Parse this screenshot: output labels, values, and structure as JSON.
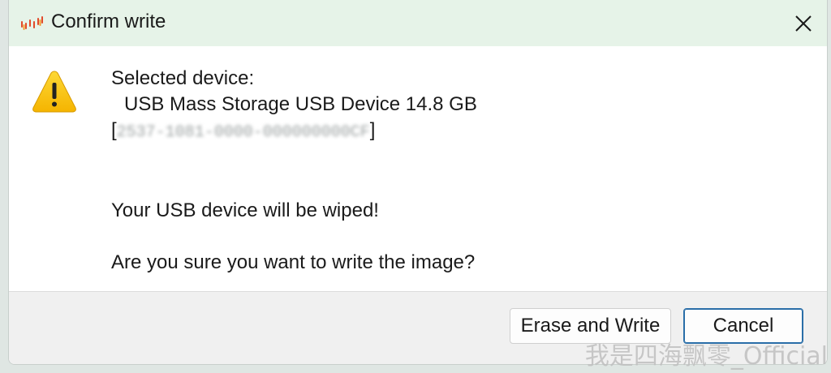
{
  "window": {
    "title": "Confirm write",
    "app_icon": "app-activity-icon",
    "close_icon": "close-icon"
  },
  "message": {
    "warning_icon": "warning-icon",
    "selected_device_label": "Selected device:",
    "device_name": "USB Mass Storage USB Device 14.8 GB",
    "device_id_open": "[",
    "device_id_blurred": "2537-1081-0000-000000000CF",
    "device_id_close": "]",
    "warning_text": "Your USB device will be wiped!",
    "question_text": "Are you sure you want to write the image?"
  },
  "buttons": {
    "erase_write_label": "Erase and Write",
    "cancel_label": "Cancel"
  },
  "watermark": {
    "text": "我是四海飘零_Official"
  },
  "colors": {
    "titlebar_bg": "#e6f3e8",
    "footer_bg": "#f0f0f0",
    "default_button_border": "#2a6ea8",
    "warning_yellow": "#f8c61b"
  }
}
